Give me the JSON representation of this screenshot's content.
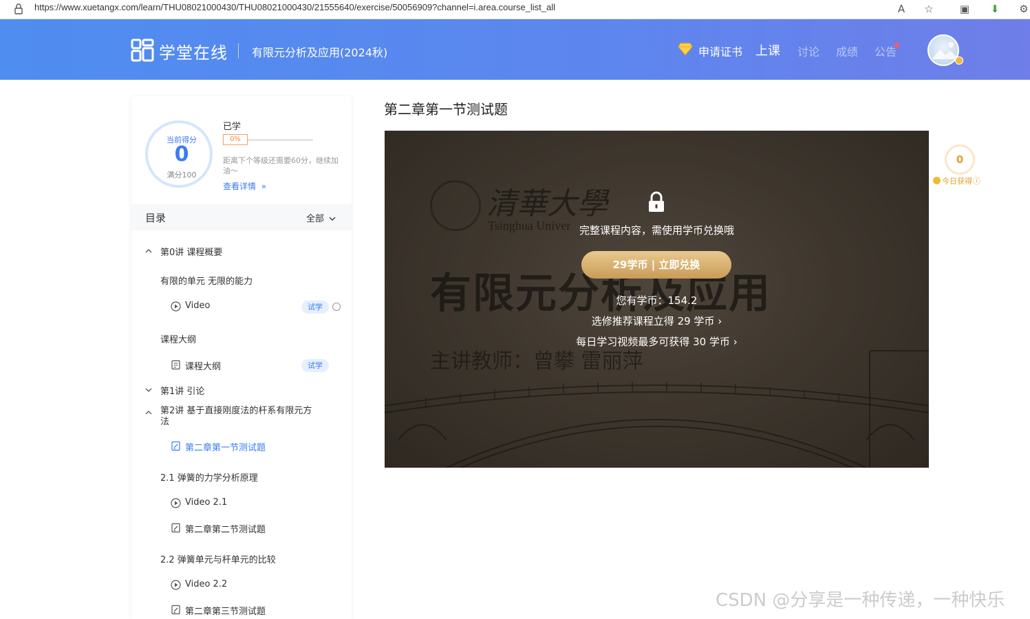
{
  "browser": {
    "url": "https://www.xuetangx.com/learn/THU08021000430/THU08021000430/21555640/exercise/50056909?channel=i.area.course_list_all"
  },
  "header": {
    "logo_text": "学堂在线",
    "course_title": "有限元分析及应用(2024秋)",
    "nav": {
      "certificate": "申请证书",
      "class": "上课",
      "discussion": "讨论",
      "grades": "成绩",
      "notice": "公告"
    },
    "brand_color": "#5a8af0"
  },
  "sidebar": {
    "score": {
      "label": "当前得分",
      "value": "0",
      "full": "满分100"
    },
    "progress": {
      "learned_label": "已学",
      "percent_text": "0%",
      "percent": 0,
      "hint": "距离下个等级还需要60分，继续加油～",
      "detail_link": "查看详情"
    },
    "toc": {
      "title": "目录",
      "filter": "全部",
      "items": [
        {
          "type": "chapter",
          "label": "第0讲 课程概要",
          "expanded": true
        },
        {
          "type": "section",
          "label": "有限的单元 无限的能力"
        },
        {
          "type": "leaf",
          "icon": "play-icon",
          "label": "Video",
          "badge": "试学"
        },
        {
          "type": "section",
          "label": "课程大纲"
        },
        {
          "type": "leaf",
          "icon": "document-icon",
          "label": "课程大纲",
          "badge": "试学"
        },
        {
          "type": "chapter",
          "label": "第1讲 引论",
          "expanded": false
        },
        {
          "type": "chapter",
          "label": "第2讲 基于直接刚度法的杆系有限元方法",
          "expanded": true
        },
        {
          "type": "leaf",
          "icon": "exercise-icon",
          "label": "第二章第一节测试题",
          "active": true
        },
        {
          "type": "section",
          "label": "2.1 弹簧的力学分析原理"
        },
        {
          "type": "leaf",
          "icon": "play-icon",
          "label": "Video 2.1"
        },
        {
          "type": "leaf",
          "icon": "exercise-icon",
          "label": "第二章第二节测试题"
        },
        {
          "type": "section",
          "label": "2.2 弹簧单元与杆单元的比较"
        },
        {
          "type": "leaf",
          "icon": "play-icon",
          "label": "Video 2.2"
        },
        {
          "type": "leaf",
          "icon": "exercise-icon",
          "label": "第二章第三节测试题"
        }
      ]
    }
  },
  "main": {
    "page_title": "第二章第一节测试题",
    "video": {
      "bg_calligraphy": "清華大學",
      "bg_english": "Tsinghua Univer",
      "bg_course": "有限元分析及应用",
      "bg_teacher": "主讲教师：曾攀 雷丽萍",
      "lock_message": "完整课程内容，需使用学币兑换哦",
      "redeem_button": "29学币 | 立即兑换",
      "balance": "您有学币：154.2",
      "elective_link": "选修推荐课程立得 29 学币",
      "daily_link": "每日学习视频最多可获得 30 学币"
    }
  },
  "widget": {
    "coins_today": "0",
    "label": "今日获得"
  },
  "watermark": "CSDN @分享是一种传递，一种快乐"
}
